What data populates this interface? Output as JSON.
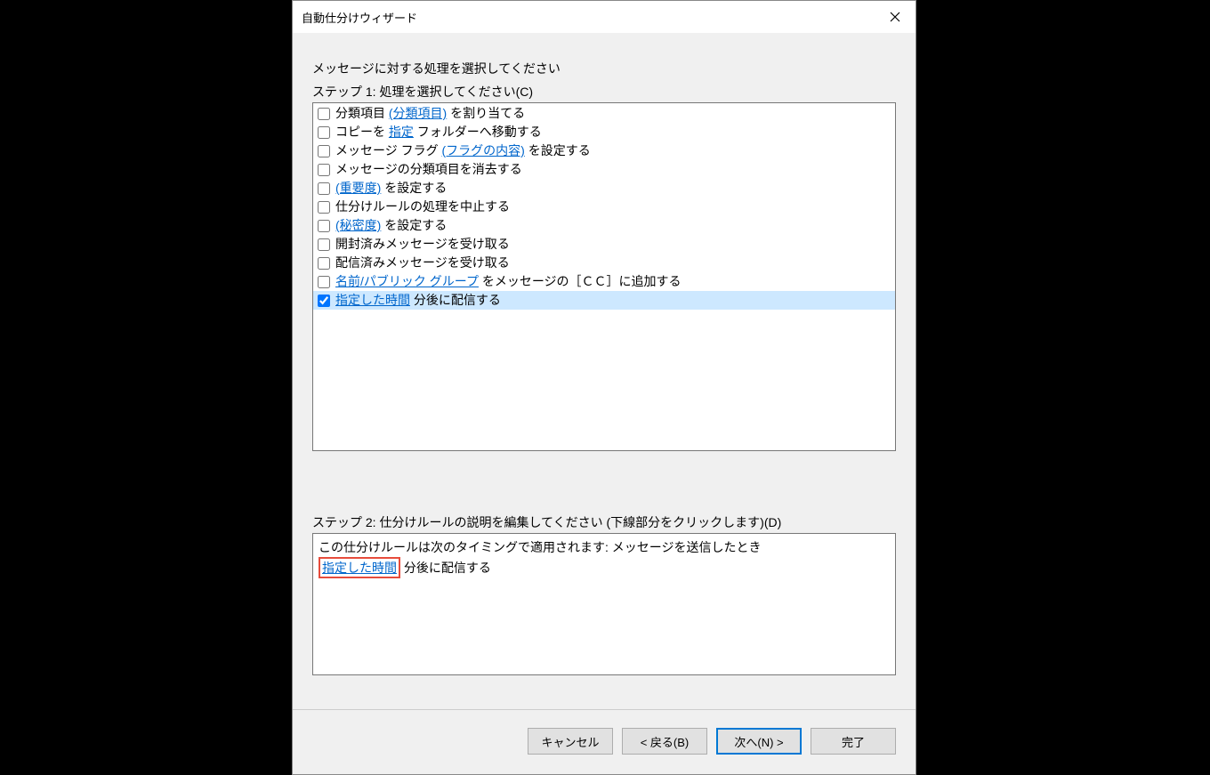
{
  "dialog": {
    "title": "自動仕分けウィザード"
  },
  "content": {
    "instruction": "メッセージに対する処理を選択してください",
    "step1_label": "ステップ 1: 処理を選択してください(C)",
    "items": [
      {
        "pre": "分類項目 ",
        "link": "(分類項目)",
        "post": " を割り当てる",
        "checked": false
      },
      {
        "pre": "コピーを ",
        "link": "指定",
        "post": " フォルダーへ移動する",
        "checked": false
      },
      {
        "pre": "メッセージ フラグ ",
        "link": "(フラグの内容)",
        "post": " を設定する",
        "checked": false
      },
      {
        "pre": "メッセージの分類項目を消去する",
        "link": "",
        "post": "",
        "checked": false
      },
      {
        "pre": "",
        "link": "(重要度)",
        "post": " を設定する",
        "checked": false
      },
      {
        "pre": "仕分けルールの処理を中止する",
        "link": "",
        "post": "",
        "checked": false
      },
      {
        "pre": "",
        "link": "(秘密度)",
        "post": " を設定する",
        "checked": false
      },
      {
        "pre": "開封済みメッセージを受け取る",
        "link": "",
        "post": "",
        "checked": false
      },
      {
        "pre": "配信済みメッセージを受け取る",
        "link": "",
        "post": "",
        "checked": false
      },
      {
        "pre": "",
        "link": "名前/パブリック グループ",
        "post": " をメッセージの［ＣＣ］に追加する",
        "checked": false
      },
      {
        "pre": "",
        "link": "指定した時間",
        "post": " 分後に配信する",
        "checked": true,
        "selected": true
      }
    ],
    "step2_label": "ステップ 2: 仕分けルールの説明を編集してください (下線部分をクリックします)(D)",
    "description": {
      "line1": "この仕分けルールは次のタイミングで適用されます: メッセージを送信したとき",
      "line2_link": "指定した時間",
      "line2_post": " 分後に配信する"
    }
  },
  "footer": {
    "cancel": "キャンセル",
    "back": "< 戻る(B)",
    "next": "次へ(N) >",
    "finish": "完了"
  }
}
